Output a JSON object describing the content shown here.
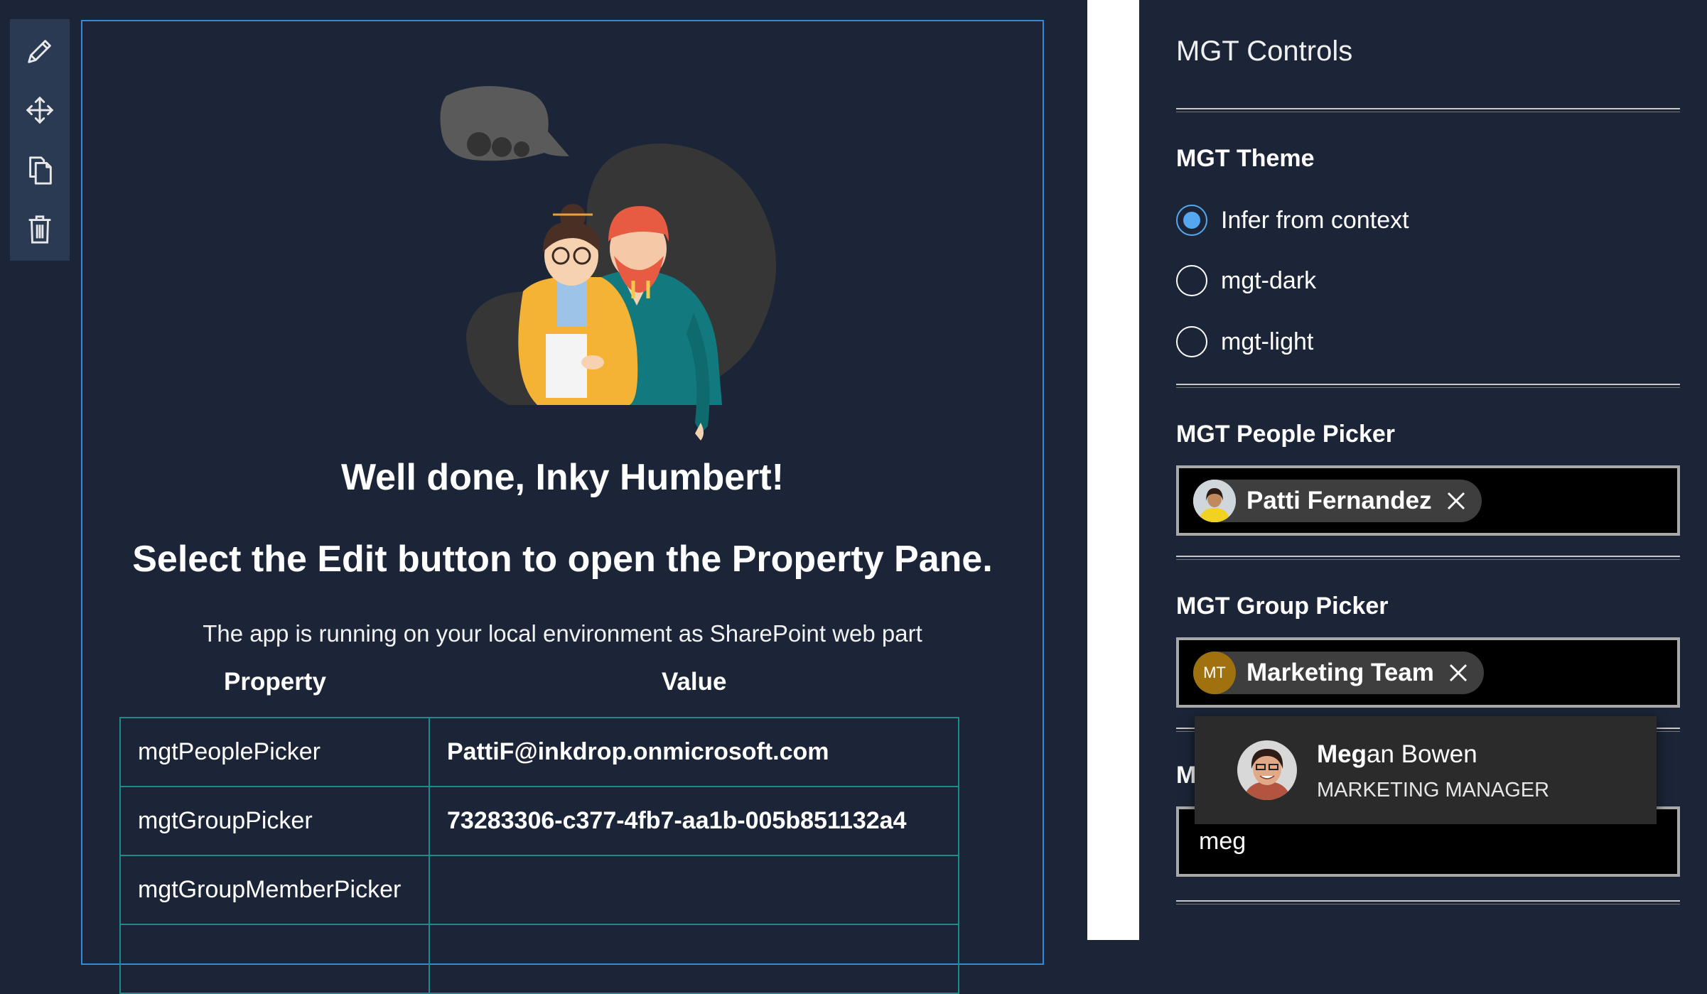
{
  "toolbar": {
    "icons": [
      "pencil-icon",
      "move-icon",
      "copy-icon",
      "trash-icon"
    ]
  },
  "webpart": {
    "greeting": "Well done, Inky Humbert!",
    "instruction": "Select the Edit button to open the Property Pane.",
    "environment": "The app is running on your local environment as SharePoint web part",
    "table": {
      "headers": [
        "Property",
        "Value"
      ],
      "rows": [
        {
          "property": "mgtPeoplePicker",
          "value": "PattiF@inkdrop.onmicrosoft.com"
        },
        {
          "property": "mgtGroupPicker",
          "value": "73283306-c377-4fb7-aa1b-005b851132a4"
        },
        {
          "property": "mgtGroupMemberPicker",
          "value": ""
        }
      ]
    }
  },
  "pane": {
    "title": "MGT Controls",
    "theme": {
      "label": "MGT Theme",
      "options": [
        "Infer from context",
        "mgt-dark",
        "mgt-light"
      ],
      "selected": "Infer from context"
    },
    "people_picker": {
      "label": "MGT People Picker",
      "selected": "Patti Fernandez"
    },
    "group_picker": {
      "label": "MGT Group Picker",
      "selected": "Marketing Team",
      "initials": "MT"
    },
    "member_picker": {
      "label_visible": "M",
      "query": "meg",
      "suggestion": {
        "name_match": "Meg",
        "name_rest": "an Bowen",
        "title": "MARKETING MANAGER"
      }
    }
  },
  "colors": {
    "background": "#1b2537",
    "toolbar": "#2b3a53",
    "webpart_border": "#2f8ad8",
    "table_border": "#1e8b8b",
    "radio_accent": "#55a8ef",
    "group_avatar": "#a0720f"
  }
}
